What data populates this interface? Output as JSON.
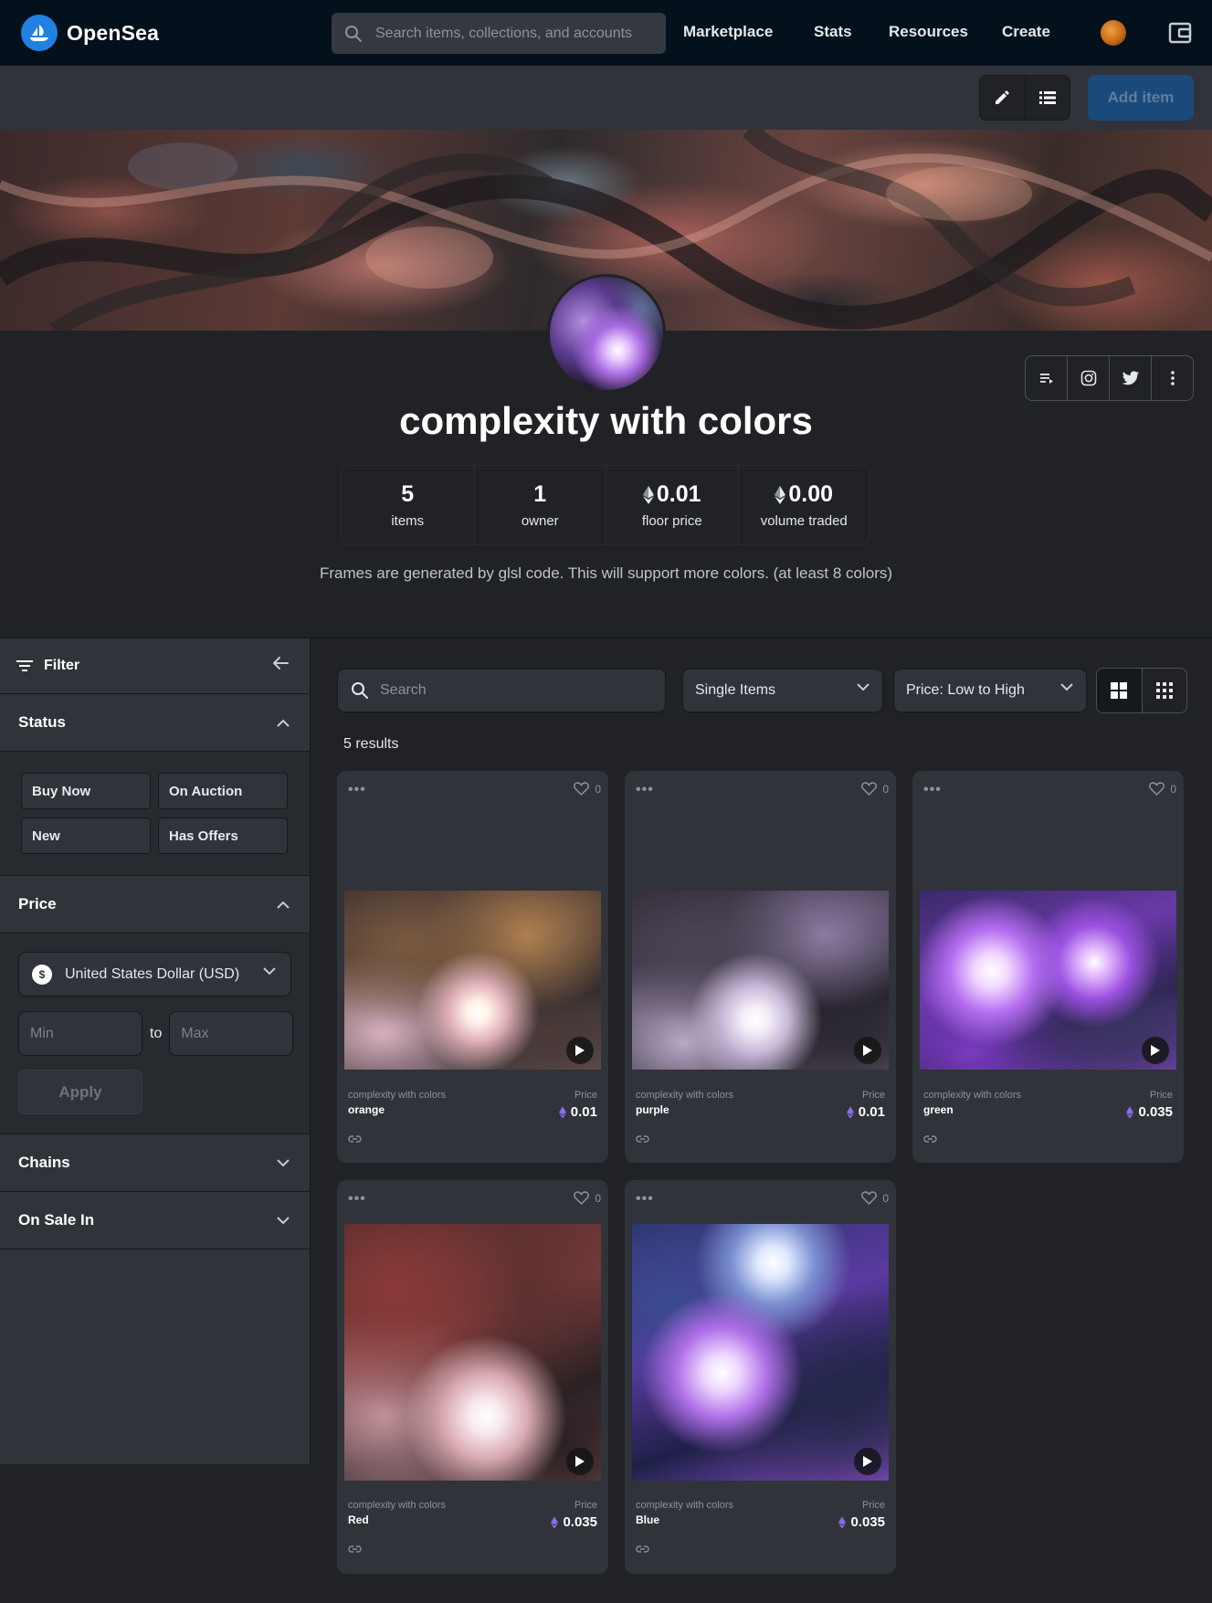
{
  "nav": {
    "brand": "OpenSea",
    "search_placeholder": "Search items, collections, and accounts",
    "links": [
      "Marketplace",
      "Stats",
      "Resources",
      "Create"
    ]
  },
  "toolbar": {
    "add_item_label": "Add item"
  },
  "collection": {
    "title": "complexity with colors",
    "description": "Frames are generated by glsl code. This will support more colors. (at least 8 colors)",
    "stats": [
      {
        "value": "5",
        "label": "items",
        "eth": false
      },
      {
        "value": "1",
        "label": "owner",
        "eth": false
      },
      {
        "value": "0.01",
        "label": "floor price",
        "eth": true
      },
      {
        "value": "0.00",
        "label": "volume traded",
        "eth": true
      }
    ]
  },
  "sidebar": {
    "filter_label": "Filter",
    "status": {
      "title": "Status",
      "options": [
        "Buy Now",
        "On Auction",
        "New",
        "Has Offers"
      ]
    },
    "price": {
      "title": "Price",
      "currency": "United States Dollar (USD)",
      "currency_symbol": "$",
      "min_placeholder": "Min",
      "max_placeholder": "Max",
      "to_label": "to",
      "apply_label": "Apply"
    },
    "chains_title": "Chains",
    "on_sale_title": "On Sale In"
  },
  "main": {
    "search_placeholder": "Search",
    "type_filter": "Single Items",
    "sort": "Price: Low to High",
    "results_label": "5 results"
  },
  "items": [
    {
      "collection": "complexity with colors",
      "name": "orange",
      "price_label": "Price",
      "price": "0.01",
      "likes": "0",
      "art": "img-orange"
    },
    {
      "collection": "complexity with colors",
      "name": "purple",
      "price_label": "Price",
      "price": "0.01",
      "likes": "0",
      "art": "img-purple"
    },
    {
      "collection": "complexity with colors",
      "name": "green",
      "price_label": "Price",
      "price": "0.035",
      "likes": "0",
      "art": "img-green"
    },
    {
      "collection": "complexity with colors",
      "name": "Red",
      "price_label": "Price",
      "price": "0.035",
      "likes": "0",
      "art": "img-red"
    },
    {
      "collection": "complexity with colors",
      "name": "Blue",
      "price_label": "Price",
      "price": "0.035",
      "likes": "0",
      "art": "img-blue"
    }
  ],
  "colors": {
    "nav_bg": "#04111d",
    "page_bg": "#202225",
    "panel_bg": "#303339",
    "accent": "#2081e2",
    "eth_purple": "#8a6cf0"
  }
}
